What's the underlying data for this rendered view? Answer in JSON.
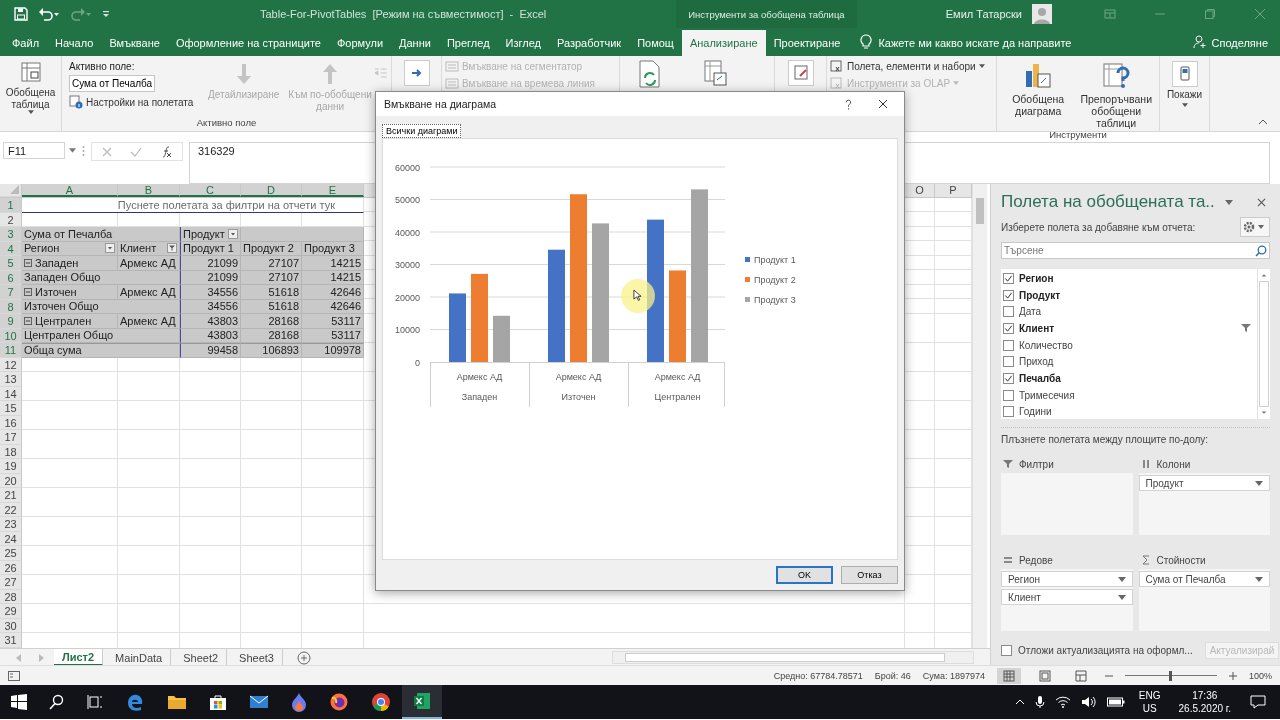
{
  "title_bar": {
    "title": "Table-For-PivotTables  [Режим на съвместимост]  -  Excel",
    "context_label": "Инструменти за обобщена таблица",
    "user": "Емил Татарски"
  },
  "ribbon_tabs": [
    {
      "label": "Файл",
      "selected": false
    },
    {
      "label": "Начало",
      "selected": false
    },
    {
      "label": "Вмъкване",
      "selected": false
    },
    {
      "label": "Оформление на страниците",
      "selected": false
    },
    {
      "label": "Формули",
      "selected": false
    },
    {
      "label": "Данни",
      "selected": false
    },
    {
      "label": "Преглед",
      "selected": false
    },
    {
      "label": "Изглед",
      "selected": false
    },
    {
      "label": "Разработчик",
      "selected": false
    },
    {
      "label": "Помощ",
      "selected": false
    },
    {
      "label": "Анализиране",
      "selected": true
    },
    {
      "label": "Проектиране",
      "selected": false
    }
  ],
  "tell_me": "Кажете ми какво искате да направите",
  "share": "Споделяне",
  "ribbon": {
    "pivot_table": "Обобщена таблица",
    "active_field_label": "Активно поле:",
    "active_field_value": "Сума от Печалба",
    "field_settings": "Настройки на полетата",
    "drill": [
      {
        "label": "Детайлизиране",
        "disabled": true
      },
      {
        "label": "Към по-обобщени данни",
        "disabled": true
      }
    ],
    "active_field_group": "Активно поле",
    "filter_commands": [
      {
        "label": "Вмъкване на сегментатор",
        "disabled": true
      },
      {
        "label": "Вмъкване на времева линия",
        "disabled": true
      }
    ],
    "calc_commands": [
      {
        "label": "Полета, елементи и набори",
        "disabled": false
      },
      {
        "label": "Инструменти за OLAP",
        "disabled": true
      }
    ],
    "pivot_chart": "Обобщена диаграма",
    "recommended": "Препоръчвани обобщени таблици",
    "tools_group": "Инструменти",
    "show": "Покажи"
  },
  "formula_bar": {
    "name_box": "F11",
    "value": "316329"
  },
  "sheet": {
    "columns": [
      "A",
      "B",
      "C",
      "D",
      "E",
      "O",
      "P"
    ],
    "row_numbers": [
      "1",
      "2",
      "3",
      "4",
      "5",
      "6",
      "7",
      "8",
      "9",
      "10",
      "11",
      "12",
      "13",
      "14",
      "15",
      "16",
      "17",
      "18",
      "19",
      "20",
      "21",
      "22",
      "23",
      "24",
      "25",
      "26",
      "27",
      "28",
      "29",
      "30",
      "31"
    ],
    "filter_hint": "Пуснете полетата за филтри на отчети тук",
    "pivot": {
      "values_title": "Сума от Печалба",
      "column_field": "Продукт",
      "row_headers": [
        "Регион",
        "Клиент"
      ],
      "column_headers": [
        "Продукт 1",
        "Продукт 2",
        "Продукт 3"
      ],
      "rows": [
        {
          "kind": "item",
          "label": "Западен",
          "client": "Армекс АД",
          "expanded": true,
          "values": [
            "21099",
            "27107",
            "14215"
          ]
        },
        {
          "kind": "subtotal",
          "label": "Западен Общо",
          "values": [
            "21099",
            "27107",
            "14215"
          ]
        },
        {
          "kind": "item",
          "label": "Източен",
          "client": "Армекс АД",
          "expanded": true,
          "values": [
            "34556",
            "51618",
            "42646"
          ]
        },
        {
          "kind": "subtotal",
          "label": "Източен Общо",
          "values": [
            "34556",
            "51618",
            "42646"
          ]
        },
        {
          "kind": "item",
          "label": "Централен",
          "client": "Армекс АД",
          "expanded": true,
          "values": [
            "43803",
            "28168",
            "53117"
          ]
        },
        {
          "kind": "subtotal",
          "label": "Централен Общо",
          "values": [
            "43803",
            "28168",
            "53117"
          ]
        },
        {
          "kind": "total",
          "label": "Обща сума",
          "values": [
            "99458",
            "106893",
            "109978"
          ]
        }
      ]
    }
  },
  "dialog": {
    "title": "Вмъкване на диаграма",
    "tab": "Всички диаграми",
    "category_groups": [
      "Западен",
      "Източен",
      "Централен"
    ],
    "chart_data": {
      "type": "bar",
      "categories": [
        "Армекс АД",
        "Армекс АД",
        "Армекс АД"
      ],
      "ylim": [
        0,
        60000
      ],
      "yticks": [
        0,
        10000,
        20000,
        30000,
        40000,
        50000,
        60000
      ],
      "grid": true,
      "legend": true,
      "series": [
        {
          "name": "Продукт 1",
          "color": "#4472c4",
          "values": [
            21099,
            34556,
            43803
          ]
        },
        {
          "name": "Продукт 2",
          "color": "#ed7d31",
          "values": [
            27107,
            51618,
            28168
          ]
        },
        {
          "name": "Продукт 3",
          "color": "#a5a5a5",
          "values": [
            14215,
            42646,
            53117
          ]
        }
      ]
    },
    "buttons": [
      {
        "label": "OK",
        "default": true
      },
      {
        "label": "Отказ",
        "default": false
      }
    ]
  },
  "field_pane": {
    "title": "Полета на обобщената та..",
    "subtitle": "Изберете полета за добавяне към отчета:",
    "search_placeholder": "Търсене",
    "fields": [
      {
        "label": "Регион",
        "checked": true,
        "filtered": false
      },
      {
        "label": "Продукт",
        "checked": true,
        "filtered": false
      },
      {
        "label": "Дата",
        "checked": false,
        "filtered": false
      },
      {
        "label": "Клиент",
        "checked": true,
        "filtered": true
      },
      {
        "label": "Количество",
        "checked": false,
        "filtered": false
      },
      {
        "label": "Приход",
        "checked": false,
        "filtered": false
      },
      {
        "label": "Печалба",
        "checked": true,
        "filtered": false
      },
      {
        "label": "Тримесечия",
        "checked": false,
        "filtered": false
      },
      {
        "label": "Години",
        "checked": false,
        "filtered": false
      }
    ],
    "drag_hint": "Плъзнете полетата между площите по-долу:",
    "areas": [
      {
        "kind": "filters",
        "label": "Филтри"
      },
      {
        "kind": "columns",
        "label": "Колони",
        "items": [
          "Продукт"
        ]
      },
      {
        "kind": "rows",
        "label": "Редове",
        "items": [
          "Регион",
          "Клиент"
        ]
      },
      {
        "kind": "values",
        "label": "Стойности",
        "items": [
          "Сума от Печалба"
        ]
      }
    ],
    "defer": {
      "label": "Отложи актуализацията на оформл...",
      "checked": false
    },
    "update_button": {
      "label": "Актуализирай",
      "disabled": true
    }
  },
  "sheet_tabs": [
    {
      "label": "Лист2",
      "selected": true
    },
    {
      "label": "MainData",
      "selected": false
    },
    {
      "label": "Sheet2",
      "selected": false
    },
    {
      "label": "Sheet3",
      "selected": false
    }
  ],
  "status_bar": {
    "average": "Средно: 67784.78571",
    "count": "Брой: 46",
    "sum": "Сума: 1897974",
    "zoom": "100%",
    "zoom_slider": {
      "level": 0.5
    }
  },
  "taskbar": {
    "language": "ENG",
    "layout": "US",
    "time": "17:36",
    "date": "26.5.2020 г."
  }
}
